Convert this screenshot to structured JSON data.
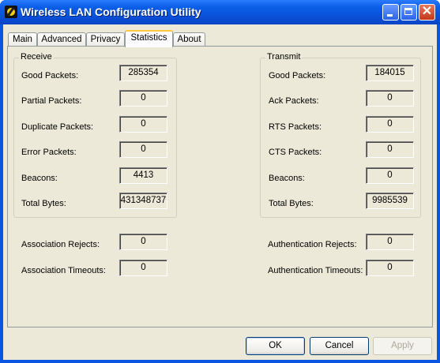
{
  "window": {
    "title": "Wireless LAN Configuration Utility"
  },
  "tabs": [
    "Main",
    "Advanced",
    "Privacy",
    "Statistics",
    "About"
  ],
  "active_tab": "Statistics",
  "receive": {
    "title": "Receive",
    "rows": [
      {
        "label": "Good Packets:",
        "value": "285354"
      },
      {
        "label": "Partial Packets:",
        "value": "0"
      },
      {
        "label": "Duplicate Packets:",
        "value": "0"
      },
      {
        "label": "Error Packets:",
        "value": "0"
      },
      {
        "label": "Beacons:",
        "value": "4413"
      },
      {
        "label": "Total Bytes:",
        "value": "431348737"
      }
    ]
  },
  "transmit": {
    "title": "Transmit",
    "rows": [
      {
        "label": "Good Packets:",
        "value": "184015"
      },
      {
        "label": "Ack Packets:",
        "value": "0"
      },
      {
        "label": "RTS Packets:",
        "value": "0"
      },
      {
        "label": "CTS Packets:",
        "value": "0"
      },
      {
        "label": "Beacons:",
        "value": "0"
      },
      {
        "label": "Total Bytes:",
        "value": "9985539"
      }
    ]
  },
  "association": {
    "rejects_label": "Association Rejects:",
    "rejects_value": "0",
    "timeouts_label": "Association Timeouts:",
    "timeouts_value": "0"
  },
  "authentication": {
    "rejects_label": "Authentication Rejects:",
    "rejects_value": "0",
    "timeouts_label": "Authentication Timeouts:",
    "timeouts_value": "0"
  },
  "buttons": {
    "ok": "OK",
    "cancel": "Cancel",
    "apply": "Apply"
  },
  "colors": {
    "titlebar": "#0a5ee6",
    "dialog_bg": "#ece9d8",
    "active_tab_accent": "#ffc83c"
  }
}
